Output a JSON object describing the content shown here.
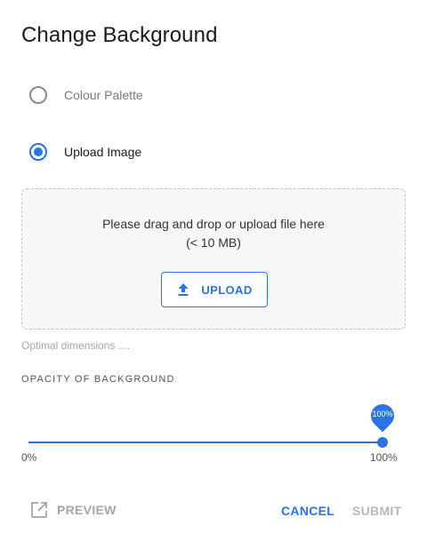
{
  "dialog": {
    "title": "Change Background"
  },
  "options": [
    {
      "label": "Colour Palette",
      "selected": false
    },
    {
      "label": "Upload Image",
      "selected": true
    }
  ],
  "dropzone": {
    "line1": "Please drag and drop or upload file here",
    "line2": "(< 10 MB)",
    "upload_label": "UPLOAD",
    "upload_icon": "upload-icon"
  },
  "hint": "Optimal dimensions ....",
  "opacity": {
    "label": "OPACITY OF BACKGROUND",
    "value_percent": 100,
    "value_label": "100%",
    "min_label": "0%",
    "max_label": "100%"
  },
  "actions": {
    "preview_label": "PREVIEW",
    "preview_icon": "open-in-new-icon",
    "cancel_label": "CANCEL",
    "submit_label": "SUBMIT"
  },
  "colors": {
    "accent": "#2b72e6",
    "muted_text": "#a6a6a6",
    "disabled_text": "#b8b8b8"
  }
}
